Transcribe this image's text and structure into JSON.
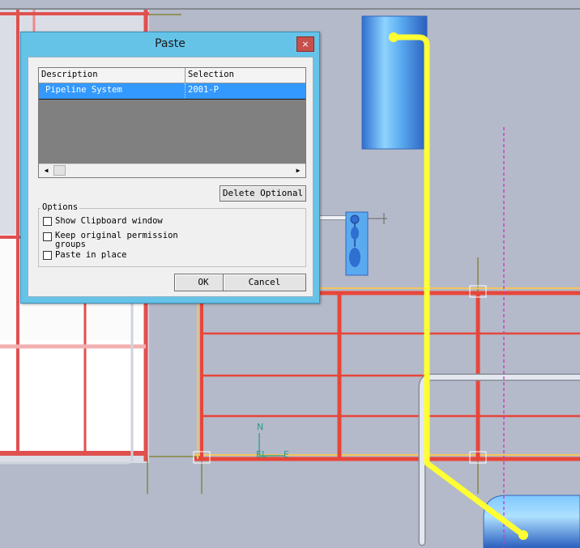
{
  "dialog": {
    "title": "Paste",
    "close_glyph": "×",
    "grid": {
      "headers": [
        "Description",
        "Selection"
      ],
      "rows": [
        {
          "description": "Pipeline System",
          "selection": "2001-P",
          "selected": true
        }
      ],
      "scroll_left_glyph": "◀",
      "scroll_right_glyph": "▶"
    },
    "delete_optional_label": "Delete Optional",
    "options": {
      "legend": "Options",
      "show_clipboard_label": "Show Clipboard window",
      "keep_permission_label_line1": "Keep original permission",
      "keep_permission_label_line2": "groups",
      "paste_in_place_label": "Paste in place",
      "show_clipboard_checked": false,
      "keep_permission_checked": false,
      "paste_in_place_checked": false
    },
    "ok_label": "OK",
    "cancel_label": "Cancel"
  },
  "scene": {
    "compass_north": "N",
    "compass_east": "E",
    "compass_el": "EL",
    "colors": {
      "background": "#b4bac9",
      "steel": "#e8453a",
      "highlight_pipe": "#ffff33",
      "pipe": "#dfe3ee",
      "vessel": "#5aaaf0",
      "centerline": "#cc33cc",
      "dialog_frame": "#66c3e8",
      "selection_row": "#3399ff"
    }
  }
}
